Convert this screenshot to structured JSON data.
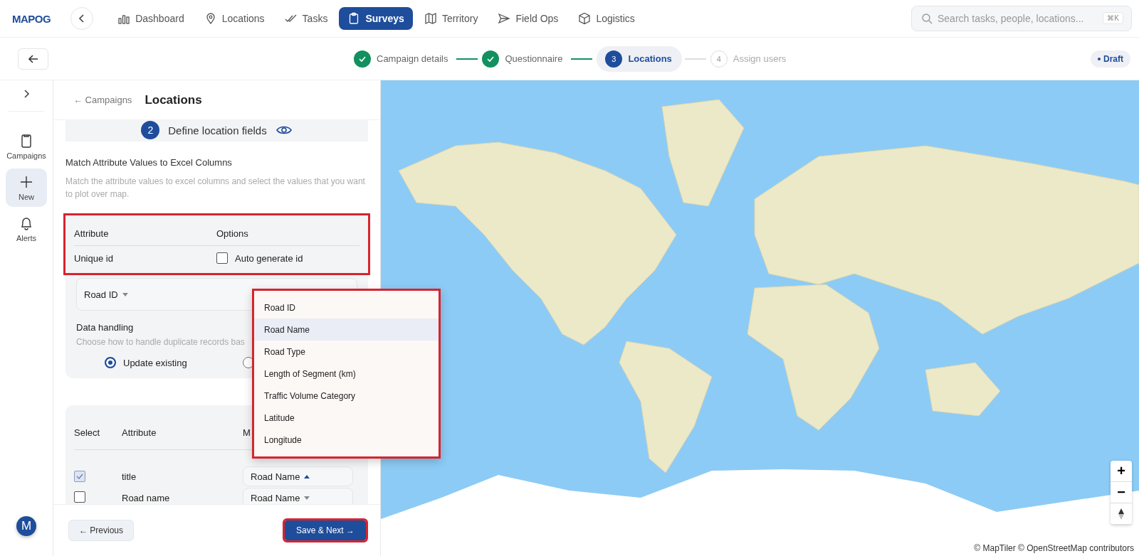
{
  "topbar": {
    "logo": "MAPOG",
    "nav": [
      {
        "label": "Dashboard",
        "selected": false
      },
      {
        "label": "Locations",
        "selected": false
      },
      {
        "label": "Tasks",
        "selected": false
      },
      {
        "label": "Surveys",
        "selected": true
      },
      {
        "label": "Territory",
        "selected": false
      },
      {
        "label": "Field Ops",
        "selected": false
      },
      {
        "label": "Logistics",
        "selected": false
      }
    ],
    "search": {
      "placeholder": "Search tasks, people, locations...",
      "shortcut": "⌘K"
    }
  },
  "stepper": {
    "steps": [
      {
        "label": "Campaign details",
        "completed": true,
        "selected": false
      },
      {
        "label": "Questionnaire",
        "completed": true,
        "selected": false
      },
      {
        "label": "Locations",
        "completed": false,
        "selected": true,
        "number": "3"
      },
      {
        "label": "Assign users",
        "completed": false,
        "selected": false,
        "number": "4"
      }
    ],
    "badge": "Draft"
  },
  "rail": {
    "items": [
      {
        "label": "Campaigns",
        "selected": false
      },
      {
        "label": "New",
        "selected": true
      },
      {
        "label": "Alerts",
        "selected": false
      }
    ],
    "avatar": "M"
  },
  "panel": {
    "breadcrumb": "← Campaigns",
    "title": "Locations",
    "step": {
      "number": "2",
      "label": "Define location fields"
    },
    "section_title": "Match Attribute Values to Excel Columns",
    "section_description": "Match the attribute values to excel columns and select the values that you want to plot over map.",
    "attribute_table": {
      "highlighted": true,
      "columns": [
        "Attribute",
        "Options"
      ],
      "attribute": "Unique id",
      "option": {
        "label": "Auto generate id",
        "checked": false
      }
    },
    "id_column": {
      "value": "Road ID",
      "open": false
    },
    "data_handling": {
      "title": "Data handling",
      "description": "Choose how to handle duplicate records bas",
      "options": [
        {
          "label": "Update existing",
          "selected": true
        },
        {
          "selected": false
        }
      ]
    },
    "mapping": {
      "columns": [
        "Select",
        "Attribute",
        "M"
      ],
      "rows": [
        {
          "checked": true,
          "attribute": "title",
          "column": "Road Name",
          "open": true
        },
        {
          "checked": false,
          "attribute": "Road name",
          "column": "Road Name",
          "open": false
        }
      ]
    },
    "dropdown": {
      "highlighted": true,
      "options": [
        {
          "label": "Road ID",
          "selected": false
        },
        {
          "label": "Road Name",
          "selected": true
        },
        {
          "label": "Road Type",
          "selected": false
        },
        {
          "label": "Length of Segment (km)",
          "selected": false
        },
        {
          "label": "Traffic Volume Category",
          "selected": false
        },
        {
          "label": "Latitude",
          "selected": false
        },
        {
          "label": "Longitude",
          "selected": false
        }
      ]
    },
    "footer": {
      "previous": "← Previous",
      "next": {
        "label": "Save & Next →",
        "highlighted": true
      }
    }
  },
  "map": {
    "zoom_in": "+",
    "zoom_out": "−",
    "attribution": "© MapTiler © OpenStreetMap contributors"
  }
}
